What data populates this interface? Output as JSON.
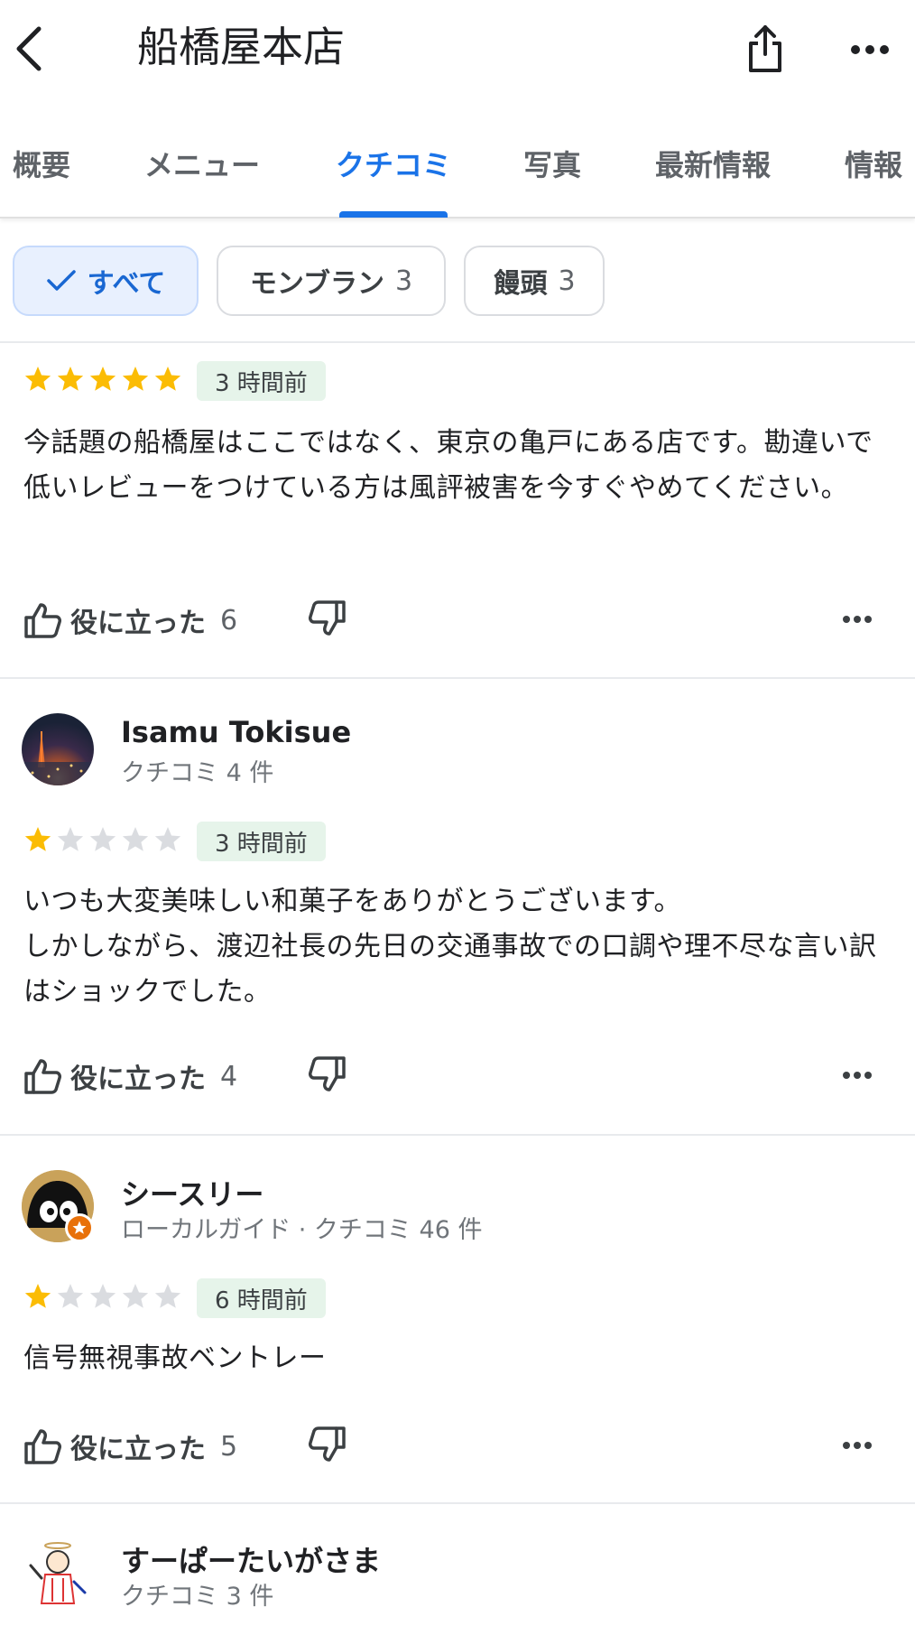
{
  "header": {
    "title": "船橋屋本店"
  },
  "tabs": [
    {
      "label": "概要"
    },
    {
      "label": "メニュー"
    },
    {
      "label": "クチコミ"
    },
    {
      "label": "写真"
    },
    {
      "label": "最新情報"
    },
    {
      "label": "情報"
    }
  ],
  "active_tab": "クチコミ",
  "chips": [
    {
      "label": "すべて",
      "count": "",
      "selected": true
    },
    {
      "label": "モンブラン",
      "count": "3",
      "selected": false
    },
    {
      "label": "饅頭",
      "count": "3",
      "selected": false
    }
  ],
  "reviews": [
    {
      "name": "",
      "meta": "",
      "rating": 5,
      "time": "3 時間前",
      "text": "今話題の船橋屋はここではなく、東京の亀戸にある店です。勘違いで低いレビューをつけている方は風評被害を今すぐやめてください。",
      "helpful_label": "役に立った",
      "helpful_count": "6"
    },
    {
      "name": "Isamu Tokisue",
      "meta": "クチコミ 4 件",
      "rating": 1,
      "time": "3 時間前",
      "text_lines": [
        "いつも大変美味しい和菓子をありがとうございます。",
        "しかしながら、渡辺社長の先日の交通事故での口調や理不尽な言い訳はショックでした。"
      ],
      "helpful_label": "役に立った",
      "helpful_count": "4"
    },
    {
      "name": "シースリー",
      "meta": "ローカルガイド · クチコミ 46 件",
      "rating": 1,
      "time": "6 時間前",
      "text": "信号無視事故ベントレー",
      "helpful_label": "役に立った",
      "helpful_count": "5"
    },
    {
      "name": "すーぱーたいがさま",
      "meta": "クチコミ 3 件"
    }
  ],
  "colors": {
    "accent": "#1a73e8",
    "star_filled": "#fbbc04",
    "star_empty": "#dadce0",
    "time_badge_bg": "#e6f4ea",
    "chip_selected_bg": "#e8f0fe"
  },
  "icons": {
    "back": "chevron-left-icon",
    "share": "share-icon",
    "more": "more-horizontal-icon",
    "check": "check-icon",
    "thumb_up": "thumb-up-icon",
    "thumb_down": "thumb-down-icon",
    "star": "star-icon"
  }
}
